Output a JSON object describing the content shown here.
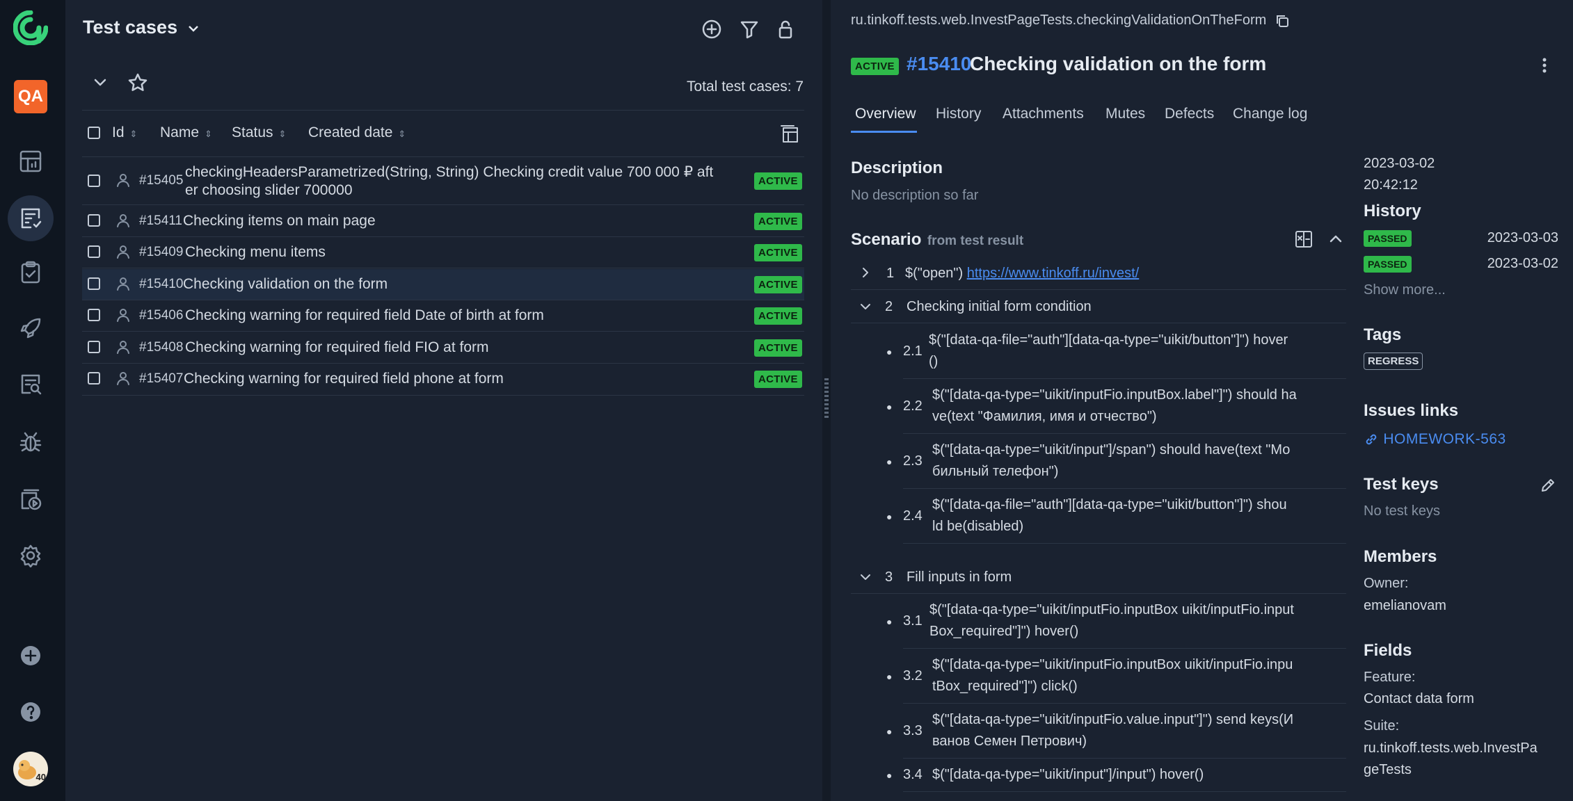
{
  "nav": {
    "logo_icon": "allure-logo",
    "project_badge": "QA",
    "items": [
      "dashboard-icon",
      "test-cases-icon",
      "test-plans-icon",
      "launches-icon",
      "analytics-icon",
      "defects-icon",
      "jobs-icon",
      "settings-icon"
    ],
    "bottom": [
      "add-icon",
      "help-icon",
      "avatar"
    ],
    "avatar_count": "40"
  },
  "left": {
    "title": "Test cases",
    "total": "Total test cases: 7",
    "columns": [
      "Id",
      "Name",
      "Status",
      "Created date"
    ],
    "rows": [
      {
        "id": "#15405",
        "name": "checkingHeadersParametrized(String, String) Checking credit value 700 000 ₽ aft",
        "name2": "er choosing slider 700000",
        "status": "ACTIVE"
      },
      {
        "id": "#15411",
        "name": "Checking items on main page",
        "status": "ACTIVE"
      },
      {
        "id": "#15409",
        "name": "Checking menu items",
        "status": "ACTIVE"
      },
      {
        "id": "#15410",
        "name": "Checking validation on the form",
        "status": "ACTIVE"
      },
      {
        "id": "#15406",
        "name": "Checking warning for required field Date of birth at form",
        "status": "ACTIVE"
      },
      {
        "id": "#15408",
        "name": "Checking warning for required field FIO at form",
        "status": "ACTIVE"
      },
      {
        "id": "#15407",
        "name": "Checking warning for required field phone at form",
        "status": "ACTIVE"
      }
    ]
  },
  "right": {
    "breadcrumb": "ru.tinkoff.tests.web.InvestPageTests.checkingValidationOnTheForm",
    "status": "ACTIVE",
    "id": "#15410",
    "title": "Checking validation on the form",
    "tabs": [
      "Overview",
      "History",
      "Attachments",
      "Mutes",
      "Defects",
      "Change log"
    ],
    "description_title": "Description",
    "description_text": "No description so far",
    "scenario_title": "Scenario",
    "scenario_sub": "from test result",
    "steps": {
      "s1_num": "1",
      "s1_text": "$(\"open\")",
      "s1_link": "https://www.tinkoff.ru/invest/",
      "s2_num": "2",
      "s2_text": "Checking initial form condition",
      "s2_1_num": "2.1",
      "s2_1_a": "$(\"[data-qa-file=\"auth\"][data-qa-type=\"uikit/button\"]\") hover",
      "s2_1_b": "()",
      "s2_2_num": "2.2",
      "s2_2_a": "$(\"[data-qa-type=\"uikit/inputFio.inputBox.label\"]\") should ha",
      "s2_2_b": "ve(text \"Фамилия, имя и отчество\")",
      "s2_3_num": "2.3",
      "s2_3_a": "$(\"[data-qa-type=\"uikit/input\"]/span\") should have(text \"Мо",
      "s2_3_b": "бильный телефон\")",
      "s2_4_num": "2.4",
      "s2_4_a": "$(\"[data-qa-file=\"auth\"][data-qa-type=\"uikit/button\"]\") shou",
      "s2_4_b": "ld be(disabled)",
      "s3_num": "3",
      "s3_text": "Fill inputs in form",
      "s3_1_num": "3.1",
      "s3_1_a": "$(\"[data-qa-type=\"uikit/inputFio.inputBox uikit/inputFio.input",
      "s3_1_b": "Box_required\"]\") hover()",
      "s3_2_num": "3.2",
      "s3_2_a": "$(\"[data-qa-type=\"uikit/inputFio.inputBox uikit/inputFio.inpu",
      "s3_2_b": "tBox_required\"]\") click()",
      "s3_3_num": "3.3",
      "s3_3_a": "$(\"[data-qa-type=\"uikit/inputFio.value.input\"]\") send keys(И",
      "s3_3_b": "ванов Семен Петрович)",
      "s3_4_num": "3.4",
      "s3_4_a": "$(\"[data-qa-type=\"uikit/input\"]/input\") hover()"
    },
    "side": {
      "created_date": "2023-03-02",
      "created_time": "20:42:12",
      "history_title": "History",
      "history": [
        {
          "status": "PASSED",
          "date": "2023-03-03"
        },
        {
          "status": "PASSED",
          "date": "2023-03-02"
        }
      ],
      "show_more": "Show more...",
      "tags_title": "Tags",
      "tag": "REGRESS",
      "issues_title": "Issues links",
      "issue": "HOMEWORK-563",
      "keys_title": "Test keys",
      "keys_text": "No test keys",
      "members_title": "Members",
      "owner_label": "Owner:",
      "owner": "emelianovam",
      "fields_title": "Fields",
      "feature_label": "Feature:",
      "feature": "Contact data form",
      "suite_label": "Suite:",
      "suite_a": "ru.tinkoff.tests.web.InvestPa",
      "suite_b": "geTests"
    }
  },
  "colors": {
    "accent": "#4a8cf0",
    "active": "#2fb94a",
    "bg": "#1a2230",
    "nav": "#0f1620",
    "qa": "#f2652a"
  }
}
